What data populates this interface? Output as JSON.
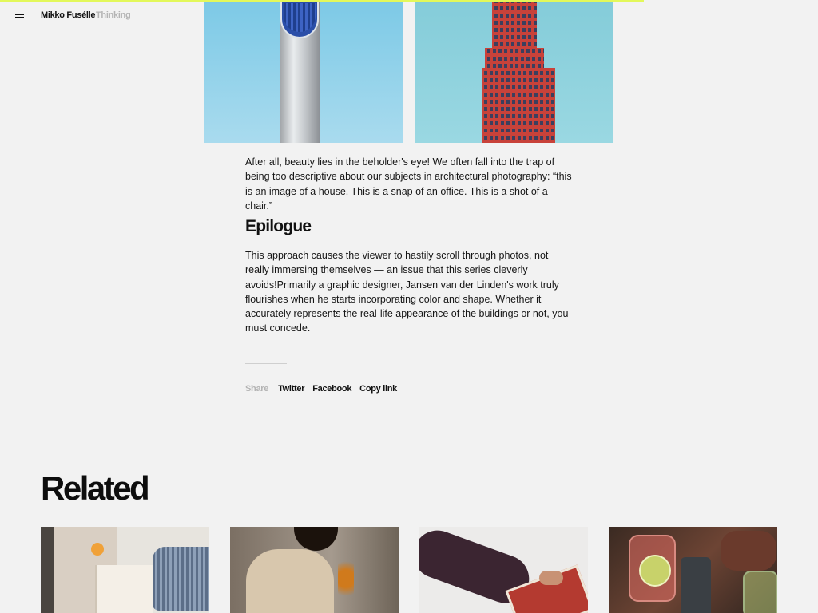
{
  "reading_progress": 0.787,
  "colors": {
    "progress": "#e3f85a",
    "background": "#f2f2f2",
    "text": "#111111",
    "muted": "#b4b4b4"
  },
  "header": {
    "menu_icon": "hamburger-menu-icon",
    "brand": "Mikko Fusélle",
    "section": "Thinking"
  },
  "article": {
    "paragraph_1": "After all, beauty lies in the beholder's eye! We often fall into the trap of being too descriptive about our subjects in architectural photography: “this is an image of a house. This is a snap of an office. This is a shot of a chair.”",
    "heading": "Epilogue",
    "paragraph_2": "This approach causes the viewer to hastily scroll through photos, not really immersing themselves — an issue that this series cleverly avoids!Primarily a graphic designer, Jansen van der Linden's work truly flourishes when he starts incorporating color and shape. Whether it accurately represents the real-life appearance of the buildings or not, you must concede."
  },
  "share": {
    "label": "Share",
    "links": [
      "Twitter",
      "Facebook",
      "Copy link"
    ]
  },
  "related": {
    "title": "Related"
  }
}
